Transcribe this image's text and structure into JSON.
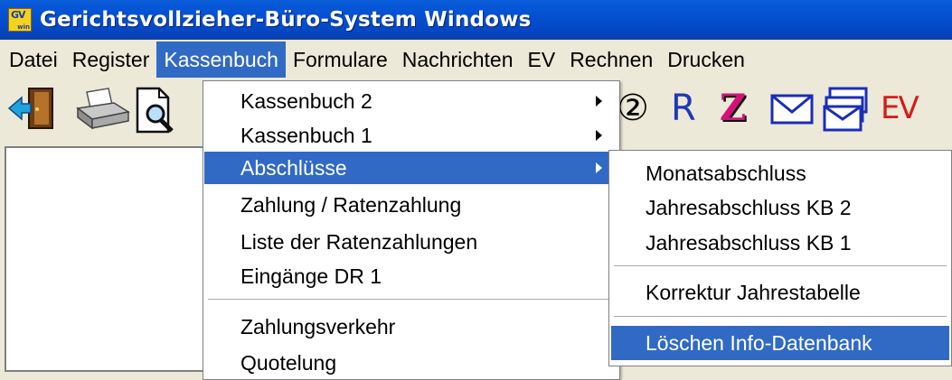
{
  "window": {
    "title": "Gerichtsvollzieher-Büro-System Windows",
    "logo_top": "GV",
    "logo_bottom": "win"
  },
  "menubar": [
    "Datei",
    "Register",
    "Kassenbuch",
    "Formulare",
    "Nachrichten",
    "EV",
    "Rechnen",
    "Drucken"
  ],
  "toolbar": {
    "icons": [
      "exit-door-icon",
      "printer-icon",
      "print-preview-icon",
      "circled-2-icon",
      "r-icon",
      "z-icon",
      "envelope-icon",
      "stacked-envelopes-icon",
      "ev-icon"
    ],
    "circled_2": "②",
    "r_label": "R",
    "z_label": "Z",
    "ev_label": "EV"
  },
  "kassenbuch_menu": {
    "items": [
      "Kassenbuch 2",
      "Kassenbuch 1",
      "Abschlüsse",
      "Zahlung / Ratenzahlung",
      "Liste der Ratenzahlungen",
      "Eingänge DR 1",
      "Zahlungsverkehr",
      "Quotelung"
    ]
  },
  "abschluesse_menu": {
    "items": [
      "Monatsabschluss",
      "Jahresabschluss KB 2",
      "Jahresabschluss KB 1",
      "Korrektur Jahrestabelle",
      "Löschen Info-Datenbank"
    ]
  },
  "colors": {
    "titlebar": "#0453d4",
    "highlight": "#316ac5",
    "menu_face": "#ece9d8"
  }
}
